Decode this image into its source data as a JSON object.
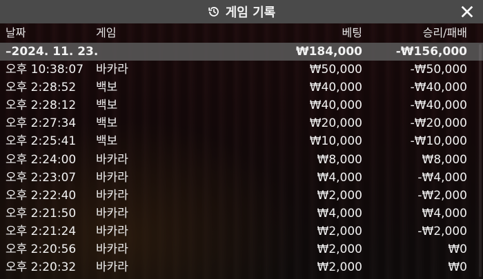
{
  "header": {
    "title": "게임 기록",
    "history_icon": "history-icon",
    "close_icon": "close-icon"
  },
  "columns": {
    "date": "날짜",
    "game": "게임",
    "bet": "베팅",
    "result": "승리/패배"
  },
  "date_row": {
    "date": "–2024. 11. 23.",
    "bet": "₩184,000",
    "result": "-₩156,000"
  },
  "rows": [
    {
      "time": "오후 10:38:07",
      "game": "바카라",
      "bet": "₩50,000",
      "result": "-₩50,000"
    },
    {
      "time": "오후 2:28:52",
      "game": "백보",
      "bet": "₩40,000",
      "result": "-₩40,000"
    },
    {
      "time": "오후 2:28:12",
      "game": "백보",
      "bet": "₩40,000",
      "result": "-₩40,000"
    },
    {
      "time": "오후 2:27:34",
      "game": "백보",
      "bet": "₩20,000",
      "result": "-₩20,000"
    },
    {
      "time": "오후 2:25:41",
      "game": "백보",
      "bet": "₩10,000",
      "result": "-₩10,000"
    },
    {
      "time": "오후 2:24:00",
      "game": "바카라",
      "bet": "₩8,000",
      "result": "₩8,000"
    },
    {
      "time": "오후 2:23:07",
      "game": "바카라",
      "bet": "₩4,000",
      "result": "-₩4,000"
    },
    {
      "time": "오후 2:22:40",
      "game": "바카라",
      "bet": "₩2,000",
      "result": "-₩2,000"
    },
    {
      "time": "오후 2:21:50",
      "game": "바카라",
      "bet": "₩4,000",
      "result": "₩4,000"
    },
    {
      "time": "오후 2:21:24",
      "game": "바카라",
      "bet": "₩2,000",
      "result": "-₩2,000"
    },
    {
      "time": "오후 2:20:56",
      "game": "바카라",
      "bet": "₩2,000",
      "result": "₩0"
    },
    {
      "time": "오후 2:20:32",
      "game": "바카라",
      "bet": "₩2,000",
      "result": "₩0"
    }
  ]
}
